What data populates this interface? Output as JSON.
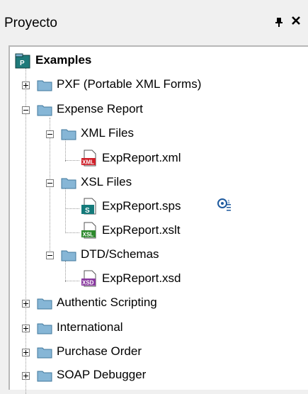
{
  "panel": {
    "title": "Proyecto",
    "pin_glyph": "⊑",
    "close_glyph": "✕"
  },
  "tree": {
    "root": {
      "label": "Examples",
      "icon": "project-icon"
    },
    "nodes": [
      {
        "label": "PXF (Portable XML Forms)",
        "state": "collapsed"
      },
      {
        "label": "Expense Report",
        "state": "expanded"
      },
      {
        "label": "XML Files",
        "state": "expanded"
      },
      {
        "label": "ExpReport.xml",
        "icon": "xml-file-icon"
      },
      {
        "label": "XSL Files",
        "state": "expanded"
      },
      {
        "label": "ExpReport.sps",
        "icon": "sps-file-icon"
      },
      {
        "label": "ExpReport.xslt",
        "icon": "xsl-file-icon"
      },
      {
        "label": "DTD/Schemas",
        "state": "expanded"
      },
      {
        "label": "ExpReport.xsd",
        "icon": "xsd-file-icon"
      },
      {
        "label": "Authentic Scripting",
        "state": "collapsed"
      },
      {
        "label": "International",
        "state": "collapsed"
      },
      {
        "label": "Purchase Order",
        "state": "collapsed"
      },
      {
        "label": "SOAP Debugger",
        "state": "collapsed"
      }
    ]
  },
  "icons": {
    "xml": {
      "text": "XML",
      "color": "#d0202a"
    },
    "sps": {
      "text": "S",
      "color": "#147a7a"
    },
    "xsl": {
      "text": "XSL",
      "color": "#2d8a2d"
    },
    "xsd": {
      "text": "XSD",
      "color": "#8a3aa0"
    },
    "folder_color": "#86b6d6",
    "project_color": "#1f7a7a"
  }
}
